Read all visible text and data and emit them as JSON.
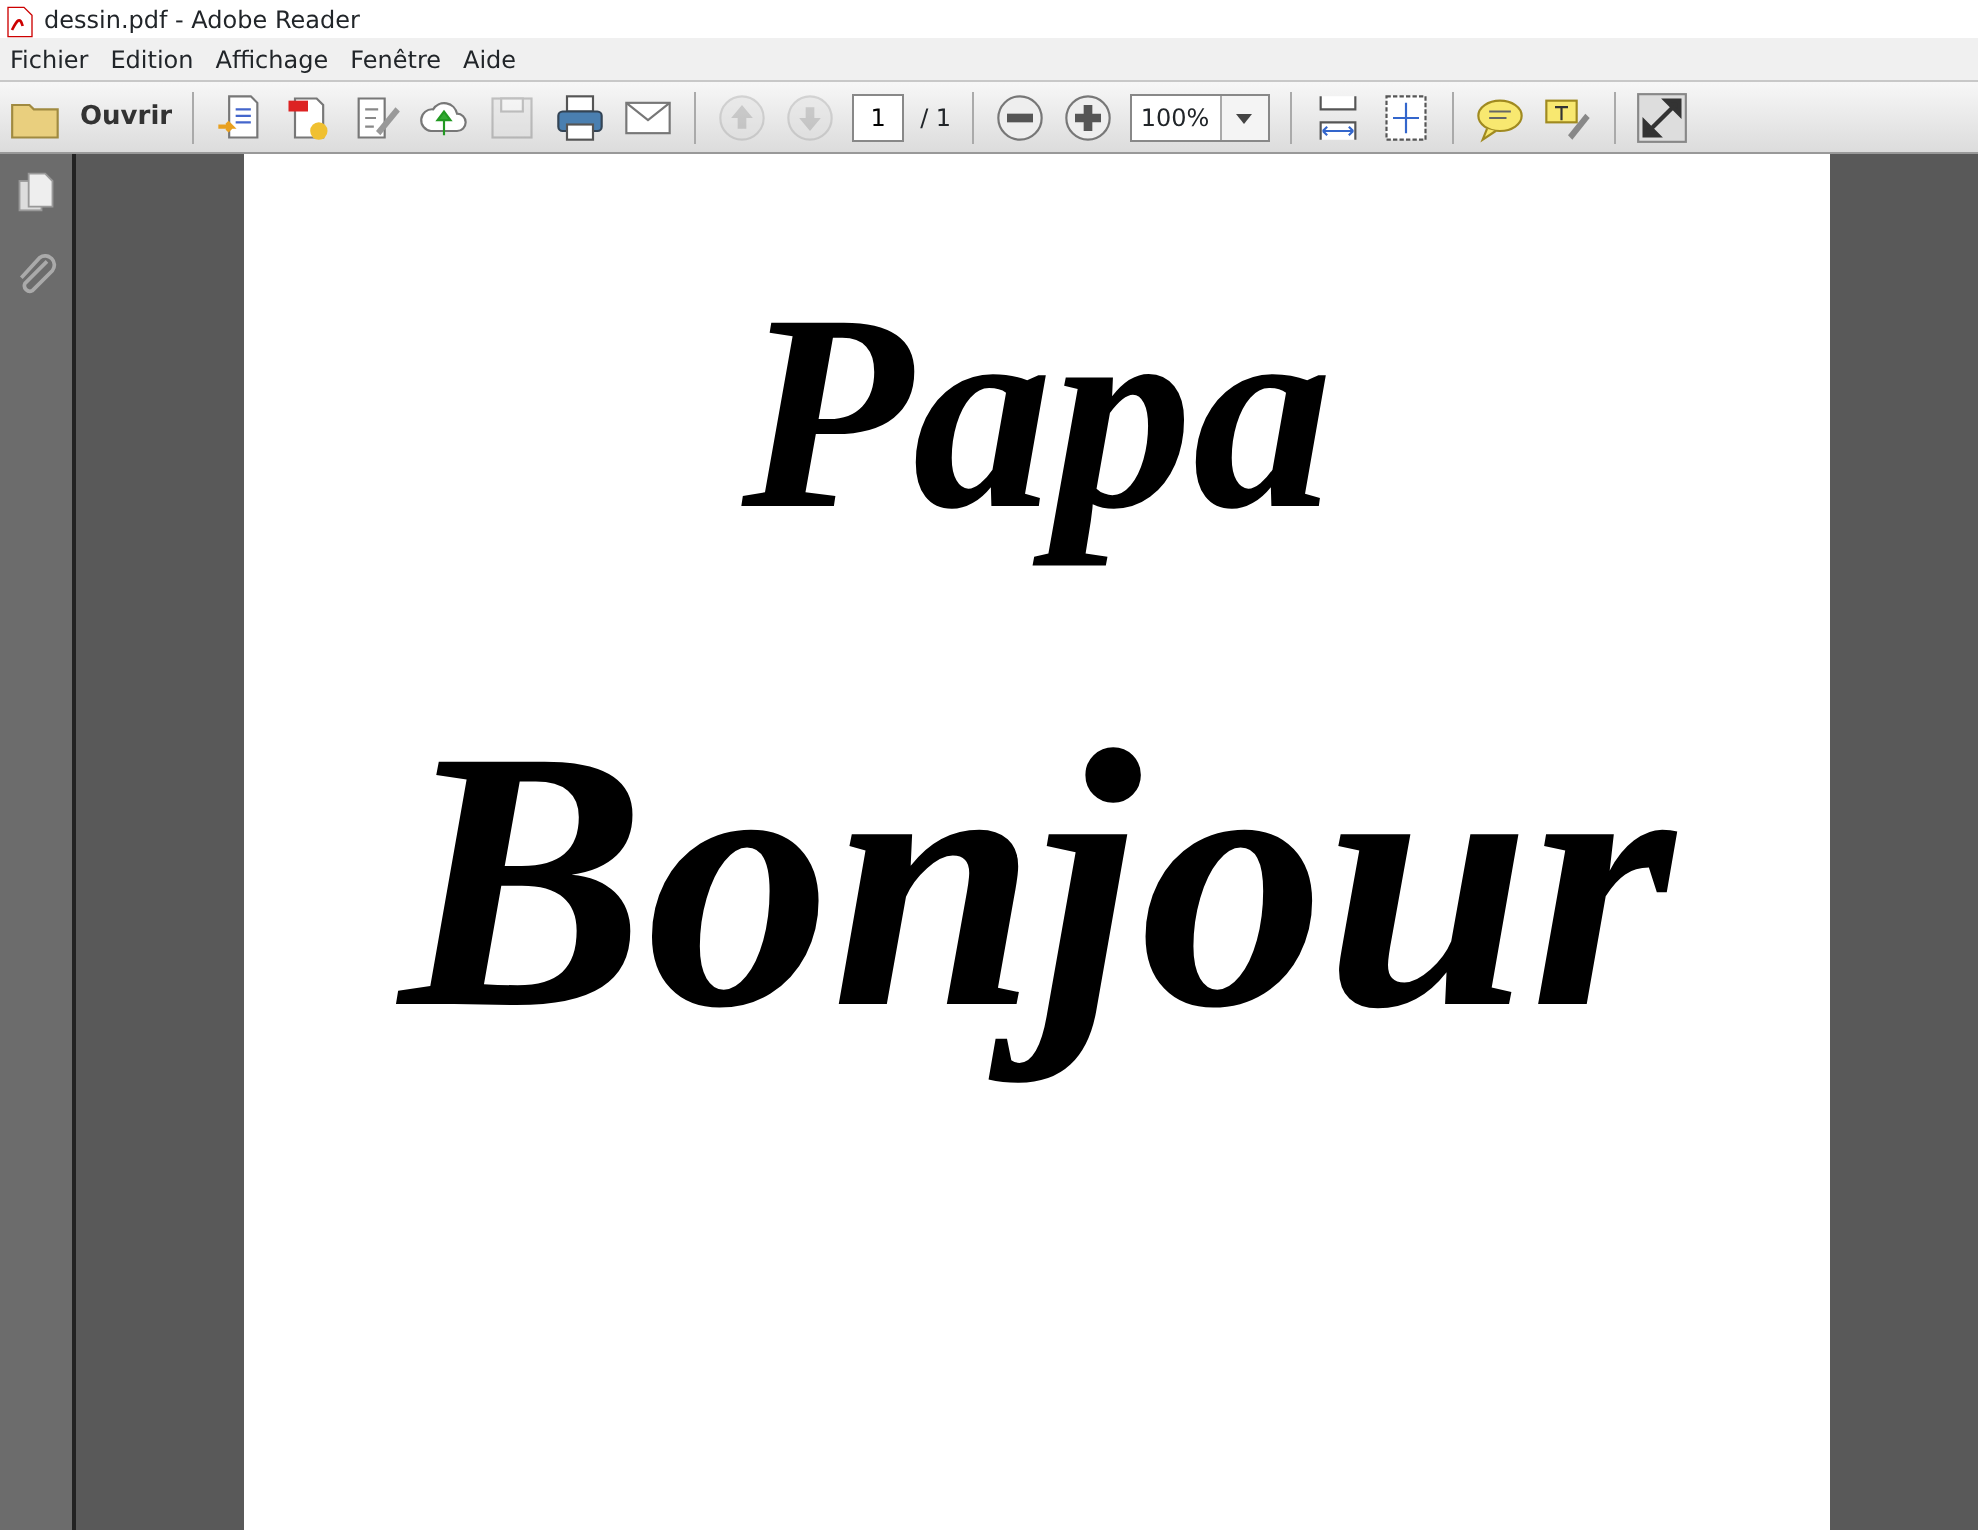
{
  "window": {
    "title": "dessin.pdf - Adobe Reader"
  },
  "menu": [
    "Fichier",
    "Edition",
    "Affichage",
    "Fenêtre",
    "Aide"
  ],
  "toolbar_groups": [
    [
      {
        "kind": "open",
        "label": "Ouvrir"
      }
    ],
    [
      {
        "kind": "create",
        "disabled": false
      },
      {
        "kind": "export",
        "disabled": false
      },
      {
        "kind": "sign",
        "disabled": false
      },
      {
        "kind": "upload",
        "disabled": false
      },
      {
        "kind": "save",
        "disabled": true
      },
      {
        "kind": "print",
        "disabled": false
      },
      {
        "kind": "mail",
        "disabled": false
      }
    ],
    [
      {
        "kind": "prev",
        "disabled": true
      },
      {
        "kind": "next",
        "disabled": true
      },
      {
        "kind": "page",
        "value": "1",
        "total": "/ 1"
      }
    ],
    [
      {
        "kind": "zoom-out",
        "disabled": false
      },
      {
        "kind": "zoom-in",
        "disabled": false
      },
      {
        "kind": "zoom",
        "value": "100%"
      }
    ],
    [
      {
        "kind": "fit-width",
        "disabled": false
      },
      {
        "kind": "fit-page",
        "disabled": false
      }
    ],
    [
      {
        "kind": "comment",
        "disabled": false
      },
      {
        "kind": "highlight",
        "disabled": false
      }
    ],
    [
      {
        "kind": "fullscreen",
        "disabled": false
      }
    ]
  ],
  "sidebar": [
    {
      "kind": "pages"
    },
    {
      "kind": "attachments"
    }
  ],
  "document": {
    "lines": [
      "Papa",
      "Bonjour"
    ]
  }
}
